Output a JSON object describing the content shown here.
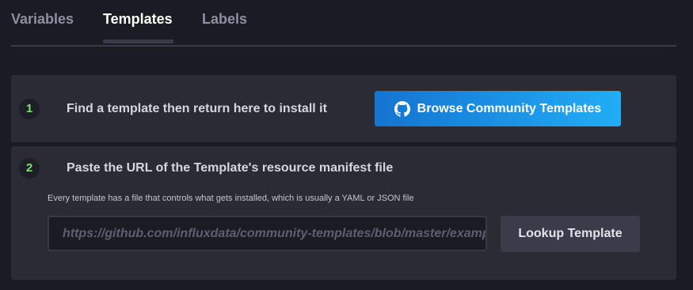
{
  "tabs": [
    {
      "label": "Variables",
      "active": false
    },
    {
      "label": "Templates",
      "active": true
    },
    {
      "label": "Labels",
      "active": false
    }
  ],
  "step1": {
    "number": "1",
    "title": "Find a template then return here to install it",
    "button_label": "Browse Community Templates",
    "button_icon": "github-icon"
  },
  "step2": {
    "number": "2",
    "title": "Paste the URL of the Template's resource manifest file",
    "hint": "Every template has a file that controls what gets installed, which is usually a YAML or JSON file",
    "url_placeholder": "https://github.com/influxdata/community-templates/blob/master/example/example.yml",
    "url_value": "",
    "lookup_label": "Lookup Template"
  },
  "colors": {
    "background": "#1b1b23",
    "panel": "#2b2b34",
    "step_number": "#7ce36e",
    "accent_gradient_start": "#1474d1",
    "accent_gradient_end": "#22adf6"
  }
}
